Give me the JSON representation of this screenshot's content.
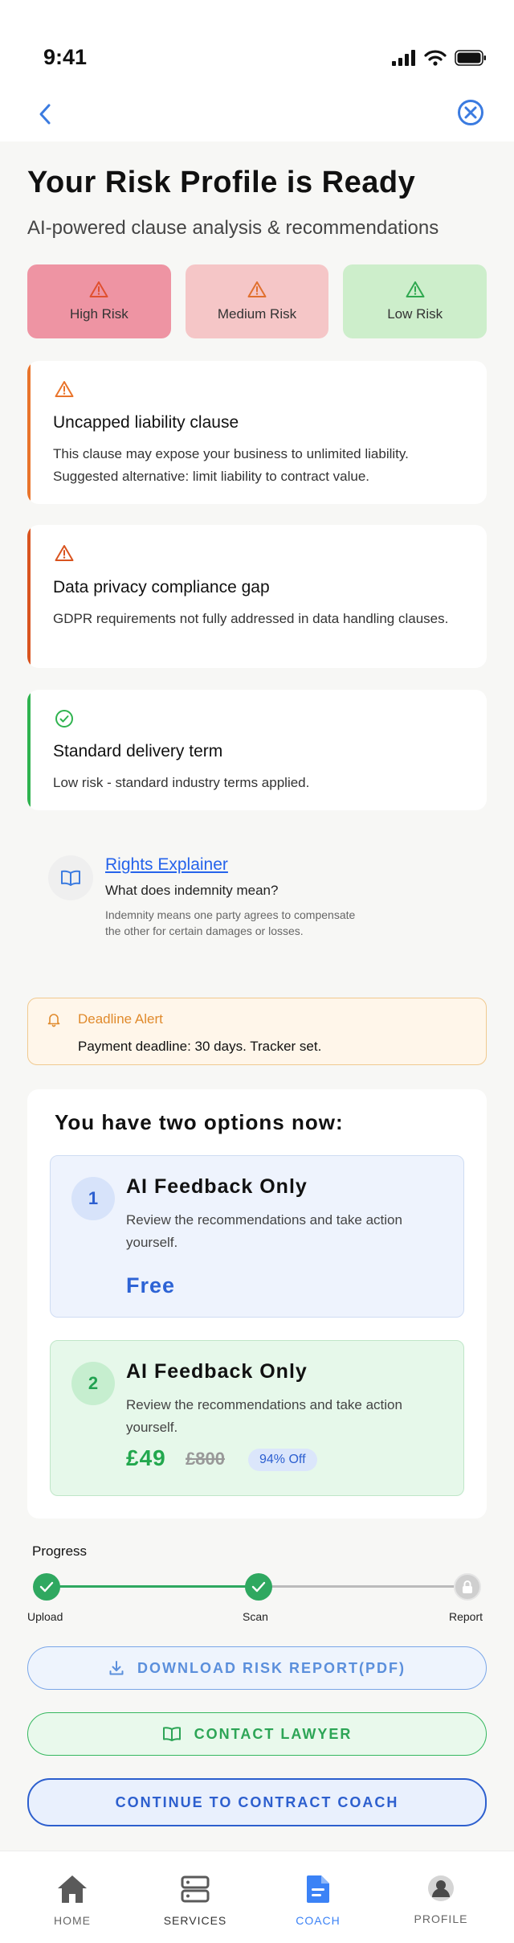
{
  "status_bar": {
    "time": "9:41"
  },
  "header": {
    "title": "Your Risk Profile is Ready",
    "subtitle": "AI-powered clause analysis & recommendations"
  },
  "risk_tabs": [
    {
      "label": "High Risk",
      "icon": "warning-icon",
      "color": "#e0502f"
    },
    {
      "label": "Medium Risk",
      "icon": "warning-icon",
      "color": "#e0702f"
    },
    {
      "label": "Low Risk",
      "icon": "warning-icon",
      "color": "#2fa84f"
    }
  ],
  "clauses": [
    {
      "title": "Uncapped liability clause",
      "description": "This clause may expose your business to unlimited liability. Suggested alternative: limit liability to contract value.",
      "icon": "warning-icon",
      "accent": "#e9742b"
    },
    {
      "title": "Data privacy compliance gap",
      "description": "GDPR requirements not fully addressed in data handling clauses.",
      "icon": "warning-icon",
      "accent": "#d9541f"
    },
    {
      "title": "Standard delivery term",
      "description": "Low risk - standard industry terms applied.",
      "icon": "check-circle-icon",
      "accent": "#2fb34f"
    }
  ],
  "explainer": {
    "title": "Rights Explainer",
    "question": "What does indemnity mean?",
    "answer": "Indemnity means one party agrees to compensate the other for certain damages or losses.",
    "icon": "book-open-icon"
  },
  "deadline": {
    "title": "Deadline Alert",
    "text": "Payment deadline: 30 days. Tracker set.",
    "icon": "bell-icon"
  },
  "options": {
    "heading": "You have two options now:",
    "items": [
      {
        "number": "1",
        "title": "AI Feedback Only",
        "description": "Review the recommendations and take action yourself.",
        "price": "Free"
      },
      {
        "number": "2",
        "title": "AI Feedback Only",
        "description": "Review the recommendations and take action yourself.",
        "price": "£49",
        "old_price": "£800",
        "discount": "94% Off"
      }
    ]
  },
  "progress": {
    "label": "Progress",
    "value": 0.5,
    "steps": [
      {
        "label": "Upload",
        "state": "done"
      },
      {
        "label": "Scan",
        "state": "done"
      },
      {
        "label": "Report",
        "state": "locked"
      }
    ]
  },
  "buttons": {
    "download": "DOWNLOAD RISK REPORT(PDF)",
    "lawyer": "CONTACT LAWYER",
    "continue": "CONTINUE TO CONTRACT COACH"
  },
  "tab_bar": [
    {
      "label": "HOME",
      "icon": "home-icon"
    },
    {
      "label": "SERVICES",
      "icon": "server-icon"
    },
    {
      "label": "COACH",
      "icon": "document-icon",
      "active": true
    },
    {
      "label": "PROFILE",
      "icon": "profile-icon"
    }
  ],
  "colors": {
    "accent_blue": "#2d5fce",
    "success_green": "#2fa860",
    "warning_orange": "#e9742b"
  }
}
